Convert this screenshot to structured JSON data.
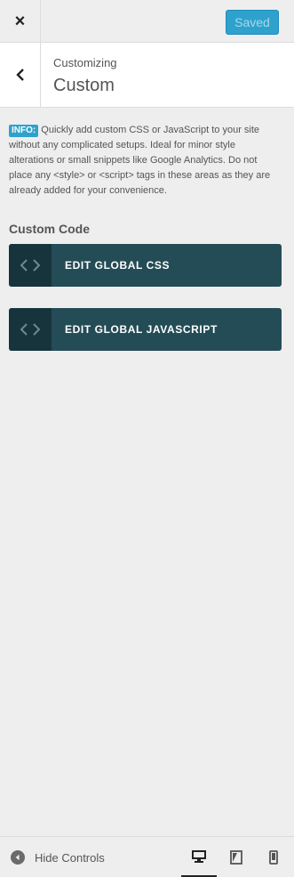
{
  "topbar": {
    "close_icon": "×",
    "saved_label": "Saved"
  },
  "section": {
    "subtitle": "Customizing",
    "title": "Custom"
  },
  "info": {
    "badge": "INFO:",
    "text": " Quickly add custom CSS or JavaScript to your site without any complicated setups. Ideal for minor style alterations or small snippets like Google Analytics. Do not place any <style> or <script> tags in these areas as they are already added for your convenience."
  },
  "custom_code": {
    "title": "Custom Code",
    "buttons": [
      {
        "label": "EDIT GLOBAL CSS"
      },
      {
        "label": "EDIT GLOBAL JAVASCRIPT"
      }
    ]
  },
  "footer": {
    "hide_controls_label": "Hide Controls"
  },
  "colors": {
    "accent": "#2ea2cc",
    "button_bg": "#244c57",
    "button_icon_bg": "#17343c"
  }
}
